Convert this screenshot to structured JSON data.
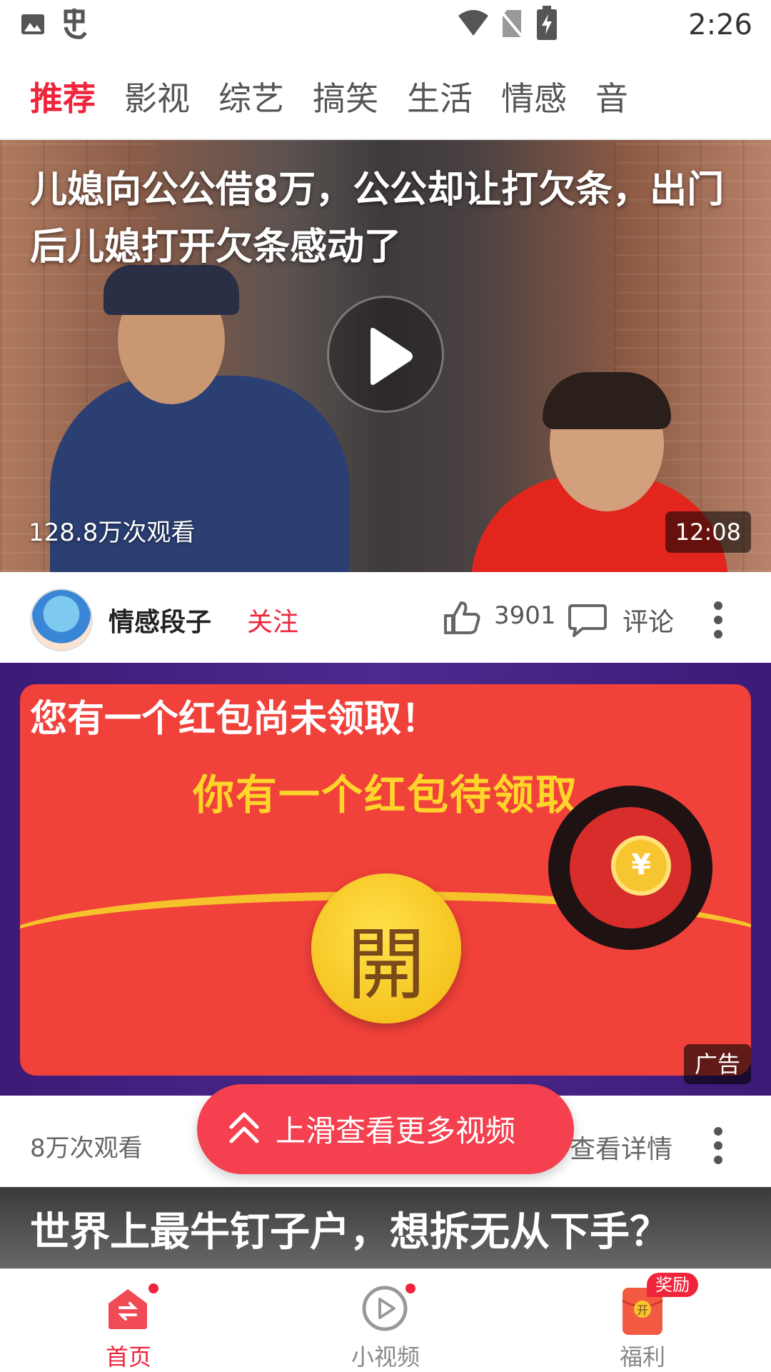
{
  "status_bar": {
    "time": "2:26",
    "icons": [
      "image-icon",
      "app-notification-icon",
      "wifi-icon",
      "no-sim-icon",
      "battery-charging-icon"
    ]
  },
  "tabs": [
    {
      "label": "推荐",
      "active": true
    },
    {
      "label": "影视",
      "active": false
    },
    {
      "label": "综艺",
      "active": false
    },
    {
      "label": "搞笑",
      "active": false
    },
    {
      "label": "生活",
      "active": false
    },
    {
      "label": "情感",
      "active": false
    },
    {
      "label": "音",
      "active": false
    }
  ],
  "video1": {
    "title": "儿媳向公公借8万，公公却让打欠条，出门后儿媳打开欠条感动了",
    "views": "128.8万次观看",
    "duration": "12:08",
    "author": "情感段子",
    "follow_label": "关注",
    "likes": "3901",
    "comment_label": "评论"
  },
  "ad": {
    "title": "您有一个红包尚未领取！",
    "subtitle": "你有一个红包待领取",
    "open_char": "開",
    "coin_symbol": "¥",
    "badge": "广告",
    "views": "8万次观看",
    "detail_label": "查看详情"
  },
  "swipe_prompt": {
    "label": "上滑查看更多视频"
  },
  "video2": {
    "title": "世界上最牛钉子户，想拆无从下手？"
  },
  "bottom_nav": {
    "items": [
      {
        "label": "首页",
        "active": true
      },
      {
        "label": "小视频",
        "active": false
      },
      {
        "label": "福利",
        "active": false
      }
    ],
    "reward_badge": "奖励",
    "reward_icon_char": "开"
  },
  "colors": {
    "accent": "#f0243a",
    "ad_bg": "#3c1a76",
    "ad_red": "#f0413a",
    "ad_gold": "#ffd52a"
  }
}
